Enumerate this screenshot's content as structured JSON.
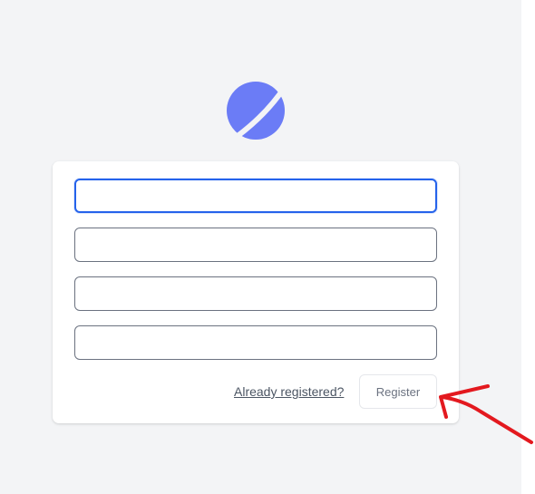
{
  "logo": {
    "icon": "planet-logo-icon",
    "color": "#6b7cf6"
  },
  "form": {
    "fields": [
      {
        "name": "field-1",
        "value": "",
        "placeholder": ""
      },
      {
        "name": "field-2",
        "value": "",
        "placeholder": ""
      },
      {
        "name": "field-3",
        "value": "",
        "placeholder": ""
      },
      {
        "name": "field-4",
        "value": "",
        "placeholder": ""
      }
    ],
    "login_link": "Already registered?",
    "submit_label": "Register"
  },
  "annotation": {
    "icon": "red-arrow-icon",
    "color": "#e3191f"
  },
  "colors": {
    "page_bg": "#f3f4f6",
    "card_bg": "#ffffff",
    "focus_border": "#2563eb",
    "field_border": "#6b7280"
  }
}
